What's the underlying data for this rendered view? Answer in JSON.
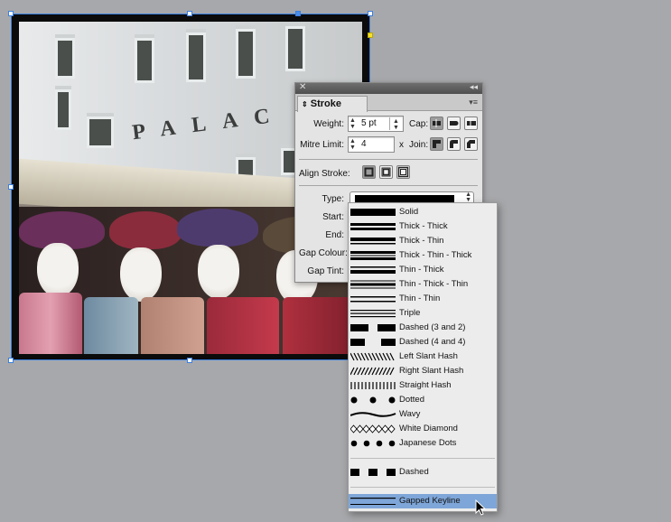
{
  "panel": {
    "title": "Stroke",
    "weight_label": "Weight:",
    "weight_value": "5 pt",
    "cap_label": "Cap:",
    "mitre_label": "Mitre Limit:",
    "mitre_value": "4",
    "mitre_x": "x",
    "join_label": "Join:",
    "align_label": "Align Stroke:",
    "type_label": "Type:",
    "start_label": "Start:",
    "end_label": "End:",
    "gap_colour_label": "Gap Colour:",
    "gap_tint_label": "Gap Tint:"
  },
  "image": {
    "sign_text": "PALAC"
  },
  "stroke_types": [
    {
      "label": "Solid",
      "icon": "solid-stroke"
    },
    {
      "label": "Thick - Thick",
      "icon": "thick-thick-stroke"
    },
    {
      "label": "Thick - Thin",
      "icon": "thick-thin-stroke"
    },
    {
      "label": "Thick - Thin - Thick",
      "icon": "thick-thin-thick-stroke"
    },
    {
      "label": "Thin - Thick",
      "icon": "thin-thick-stroke"
    },
    {
      "label": "Thin - Thick - Thin",
      "icon": "thin-thick-thin-stroke"
    },
    {
      "label": "Thin - Thin",
      "icon": "thin-thin-stroke"
    },
    {
      "label": "Triple",
      "icon": "triple-stroke"
    },
    {
      "label": "Dashed (3 and 2)",
      "icon": "dashed-3-2-stroke"
    },
    {
      "label": "Dashed (4 and 4)",
      "icon": "dashed-4-4-stroke"
    },
    {
      "label": "Left Slant Hash",
      "icon": "left-slant-hash-stroke"
    },
    {
      "label": "Right Slant Hash",
      "icon": "right-slant-hash-stroke"
    },
    {
      "label": "Straight Hash",
      "icon": "straight-hash-stroke"
    },
    {
      "label": "Dotted",
      "icon": "dotted-stroke"
    },
    {
      "label": "Wavy",
      "icon": "wavy-stroke"
    },
    {
      "label": "White Diamond",
      "icon": "white-diamond-stroke"
    },
    {
      "label": "Japanese Dots",
      "icon": "japanese-dots-stroke"
    },
    {
      "label": "Dashed",
      "icon": "dashed-stroke"
    },
    {
      "label": "Gapped Keyline",
      "icon": "gapped-keyline-stroke",
      "highlighted": true
    }
  ],
  "colors": {
    "highlight": "#7ea6d8",
    "selection": "#3b7fe0",
    "canvas": "#a7a8ab"
  }
}
